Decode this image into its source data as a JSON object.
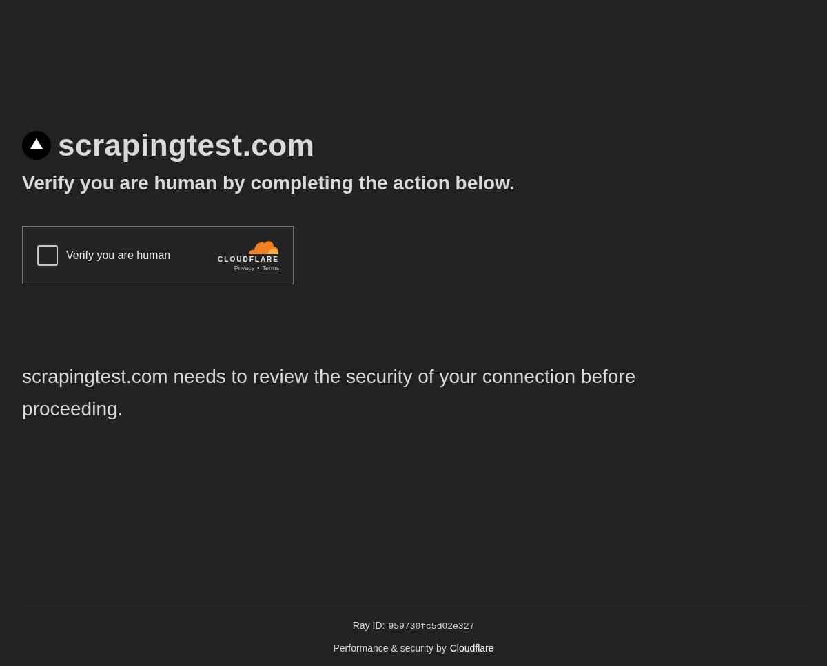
{
  "site": {
    "name": "scrapingtest.com"
  },
  "heading": "Verify you are human by completing the action below.",
  "widget": {
    "checkbox": {
      "label": "Verify you are human",
      "checked": false
    },
    "brand": "CLOUDFLARE",
    "links": [
      "Privacy",
      "Terms"
    ],
    "separator": "•"
  },
  "message": "scrapingtest.com needs to review the security of your connection before proceeding.",
  "footer": {
    "ray_label": "Ray ID:",
    "ray_id": "959730fc5d02e327",
    "credit_text": "Performance & security by",
    "credit_link": "Cloudflare"
  }
}
